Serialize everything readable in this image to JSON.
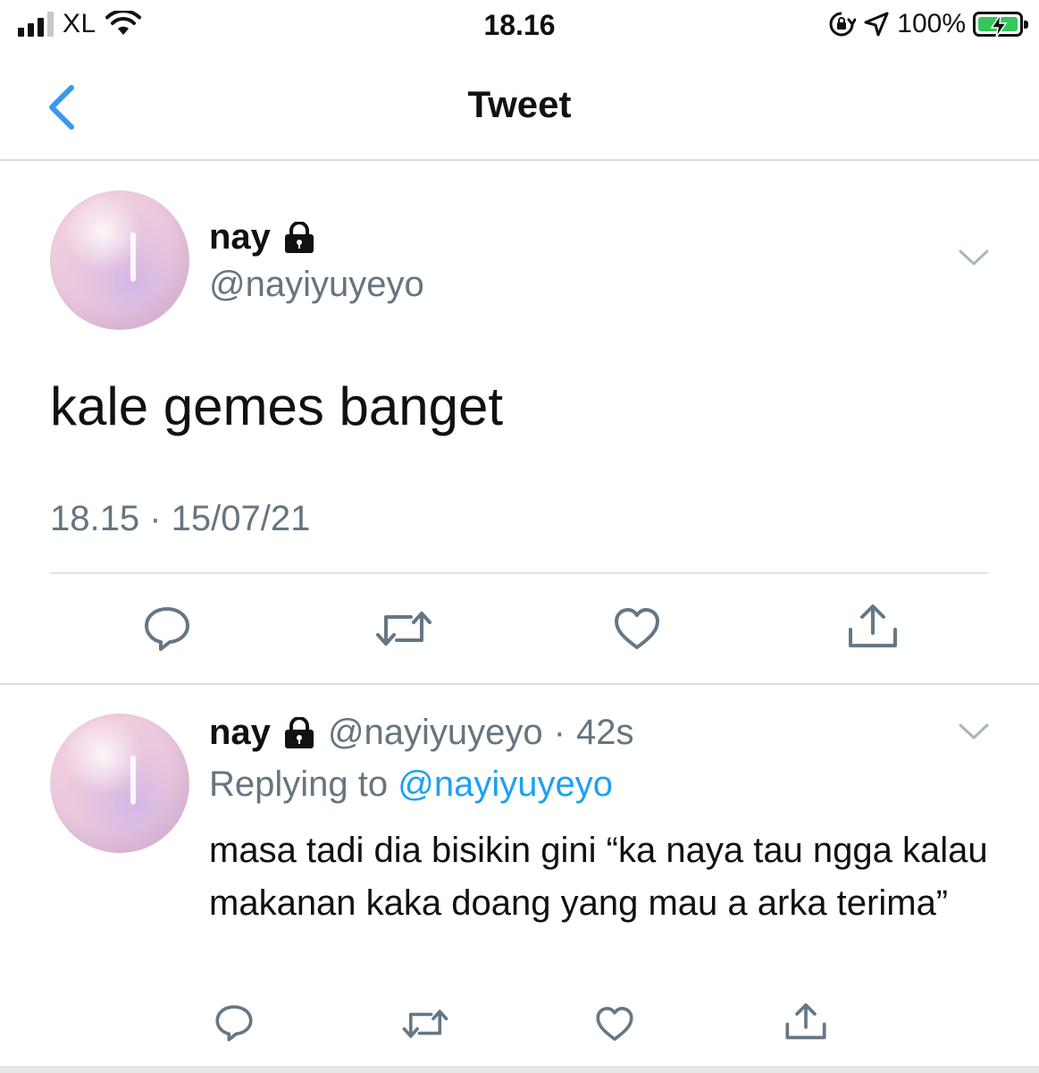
{
  "status_bar": {
    "carrier": "XL",
    "time": "18.16",
    "battery_percent": "100%",
    "signal_bars_active": 3,
    "signal_bars_total": 4,
    "icons": [
      "signal-icon",
      "wifi-icon",
      "orientation-lock-icon",
      "location-icon",
      "battery-charging-icon"
    ]
  },
  "header": {
    "title": "Tweet",
    "back_icon": "chevron-left-icon"
  },
  "main_tweet": {
    "author_name": "nay",
    "author_handle": "@nayiyuyeyo",
    "locked_icon": "lock-icon",
    "text": "kale gemes banget",
    "timestamp": "18.15 · 15/07/21",
    "actions": [
      "reply-icon",
      "retweet-icon",
      "like-icon",
      "share-icon"
    ]
  },
  "reply_tweet": {
    "author_name": "nay",
    "author_handle": "@nayiyuyeyo",
    "dot": "·",
    "age": "42s",
    "replying_prefix": "Replying to",
    "replying_to": "@nayiyuyeyo",
    "text": "masa tadi dia bisikin gini “ka naya tau ngga kalau makanan kaka doang yang mau a arka terima”",
    "actions": [
      "reply-icon",
      "retweet-icon",
      "like-icon",
      "share-icon"
    ]
  },
  "colors": {
    "accent": "#1da1f2",
    "secondary_text": "#66757f",
    "icon_gray": "#657786",
    "back_blue": "#3897f0",
    "battery_green": "#34c759"
  }
}
